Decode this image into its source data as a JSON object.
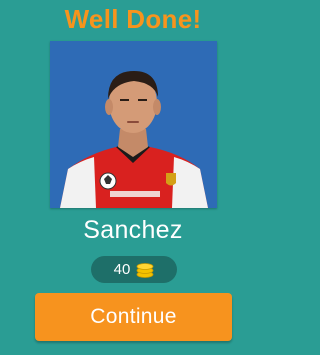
{
  "header": {
    "title": "Well Done!"
  },
  "player": {
    "name": "Sanchez",
    "photo": "player-photo"
  },
  "coins": {
    "count": "40",
    "icon": "coin-stack-icon"
  },
  "actions": {
    "continue_label": "Continue"
  },
  "colors": {
    "background": "#2a9d94",
    "accent": "#f7941d",
    "pill": "#1e6f69",
    "photo_background": "#2e6bb6"
  }
}
